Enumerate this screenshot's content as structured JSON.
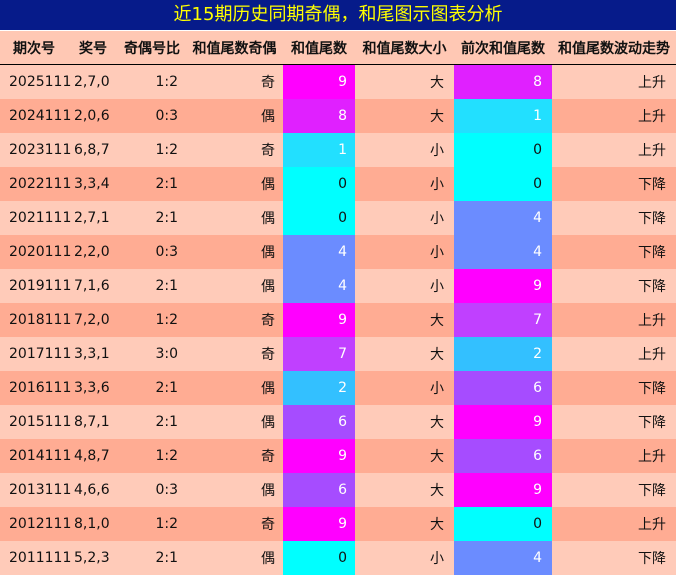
{
  "title": "近15期历史同期奇偶，和尾图示图表分析",
  "headers": [
    "期次号",
    "奖号",
    "奇偶号比",
    "和值尾数奇偶",
    "和值尾数",
    "和值尾数大小",
    "前次和值尾数",
    "和值尾数波动走势"
  ],
  "tail_colors": {
    "0": "#00ffff",
    "1": "#22e0ff",
    "2": "#33c0ff",
    "4": "#6b8cff",
    "6": "#a64cff",
    "7": "#c040ff",
    "8": "#e020ff",
    "9": "#ff00ff"
  },
  "rows": [
    {
      "period": "2025111",
      "numbers": "2,7,0",
      "ratio": "1:2",
      "oe": "奇",
      "tail": "9",
      "size": "大",
      "prev": "8",
      "trend": "上升"
    },
    {
      "period": "2024111",
      "numbers": "2,0,6",
      "ratio": "0:3",
      "oe": "偶",
      "tail": "8",
      "size": "大",
      "prev": "1",
      "trend": "上升"
    },
    {
      "period": "2023111",
      "numbers": "6,8,7",
      "ratio": "1:2",
      "oe": "奇",
      "tail": "1",
      "size": "小",
      "prev": "0",
      "trend": "上升"
    },
    {
      "period": "2022111",
      "numbers": "3,3,4",
      "ratio": "2:1",
      "oe": "偶",
      "tail": "0",
      "size": "小",
      "prev": "0",
      "trend": "下降"
    },
    {
      "period": "2021111",
      "numbers": "2,7,1",
      "ratio": "2:1",
      "oe": "偶",
      "tail": "0",
      "size": "小",
      "prev": "4",
      "trend": "下降"
    },
    {
      "period": "2020111",
      "numbers": "2,2,0",
      "ratio": "0:3",
      "oe": "偶",
      "tail": "4",
      "size": "小",
      "prev": "4",
      "trend": "下降"
    },
    {
      "period": "2019111",
      "numbers": "7,1,6",
      "ratio": "2:1",
      "oe": "偶",
      "tail": "4",
      "size": "小",
      "prev": "9",
      "trend": "下降"
    },
    {
      "period": "2018111",
      "numbers": "7,2,0",
      "ratio": "1:2",
      "oe": "奇",
      "tail": "9",
      "size": "大",
      "prev": "7",
      "trend": "上升"
    },
    {
      "period": "2017111",
      "numbers": "3,3,1",
      "ratio": "3:0",
      "oe": "奇",
      "tail": "7",
      "size": "大",
      "prev": "2",
      "trend": "上升"
    },
    {
      "period": "2016111",
      "numbers": "3,3,6",
      "ratio": "2:1",
      "oe": "偶",
      "tail": "2",
      "size": "小",
      "prev": "6",
      "trend": "下降"
    },
    {
      "period": "2015111",
      "numbers": "8,7,1",
      "ratio": "2:1",
      "oe": "偶",
      "tail": "6",
      "size": "大",
      "prev": "9",
      "trend": "下降"
    },
    {
      "period": "2014111",
      "numbers": "4,8,7",
      "ratio": "1:2",
      "oe": "奇",
      "tail": "9",
      "size": "大",
      "prev": "6",
      "trend": "上升"
    },
    {
      "period": "2013111",
      "numbers": "4,6,6",
      "ratio": "0:3",
      "oe": "偶",
      "tail": "6",
      "size": "大",
      "prev": "9",
      "trend": "下降"
    },
    {
      "period": "2012111",
      "numbers": "8,1,0",
      "ratio": "1:2",
      "oe": "奇",
      "tail": "9",
      "size": "大",
      "prev": "0",
      "trend": "上升"
    },
    {
      "period": "2011111",
      "numbers": "5,2,3",
      "ratio": "2:1",
      "oe": "偶",
      "tail": "0",
      "size": "小",
      "prev": "4",
      "trend": "下降"
    }
  ]
}
